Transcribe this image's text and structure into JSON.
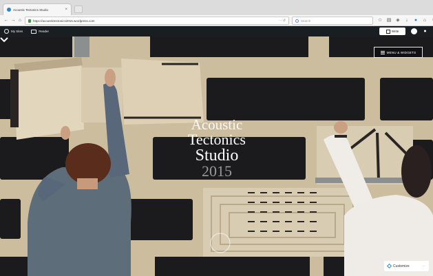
{
  "browser": {
    "tab_title": "Acoustic Tectonics Studio",
    "tab_close": "×",
    "url": "https://acoustictectonics2015.wordpress.com",
    "url_right": "⋯ ↺",
    "search_placeholder": "Search"
  },
  "adminbar": {
    "my_sites": "My Sites",
    "reader": "Reader",
    "write": "Write"
  },
  "hero": {
    "title_line1": "Acoustic",
    "title_line2": "Tectonics",
    "title_line3": "Studio",
    "title_line4": "2015",
    "menu_button": "MENU & WIDGETS"
  },
  "customize": {
    "label": "Customize",
    "more": "⋯"
  },
  "colors": {
    "admin_bar": "#191e23",
    "accent": "#2f86c6",
    "plywood": "#c9b99d"
  }
}
